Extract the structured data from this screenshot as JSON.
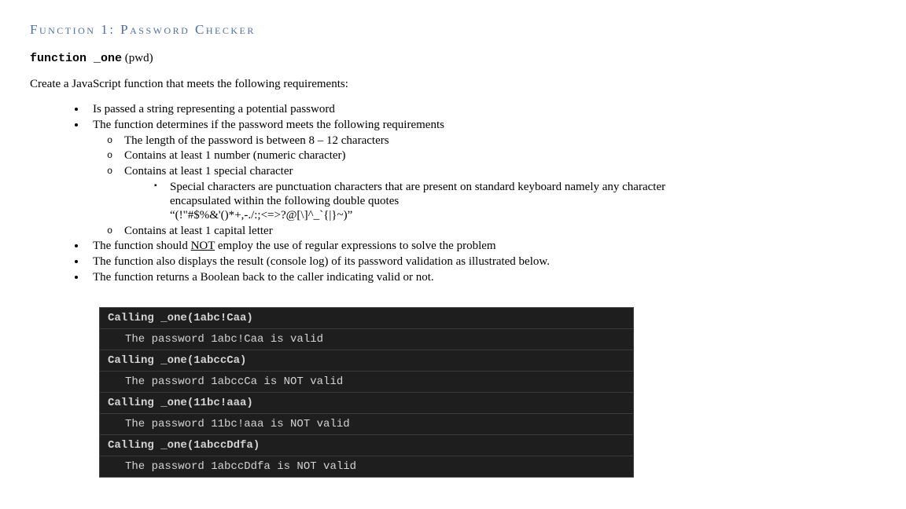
{
  "title": "Function 1: Password Checker",
  "signature": {
    "fn": "function _one",
    "args": " (pwd)"
  },
  "intro": "Create a JavaScript function that meets the following requirements:",
  "reqs": {
    "r1": "Is passed a string representing a potential password",
    "r2": "The function determines if the password meets the following requirements",
    "r2a": "The length of the password is between 8 – 12 characters",
    "r2b": "Contains at least 1 number (numeric character)",
    "r2c": "Contains at least 1 special character",
    "r2c1a": "Special characters are punctuation characters that are present on standard keyboard namely any character encapsulated within the following double quotes",
    "r2c1b": "“(!\"#$%&'()*+,-./:;<=>?@[\\]^_`{|}~)”",
    "r2d": "Contains at least 1 capital letter",
    "r3a": "The function should ",
    "r3not": "NOT",
    "r3b": " employ the use of regular expressions to solve the problem",
    "r4": "The function also displays the result (console log) of its password validation as illustrated below.",
    "r5": "The function returns a Boolean back to the caller indicating valid or not."
  },
  "console": {
    "l1": "Calling _one(1abc!Caa)",
    "l2": "The password 1abc!Caa is valid",
    "l3": "Calling _one(1abccCa)",
    "l4": "The password 1abccCa is NOT valid",
    "l5": "Calling _one(11bc!aaa)",
    "l6": "The password 11bc!aaa is NOT valid",
    "l7": "Calling _one(1abccDdfa)",
    "l8": "The password 1abccDdfa is NOT valid"
  }
}
